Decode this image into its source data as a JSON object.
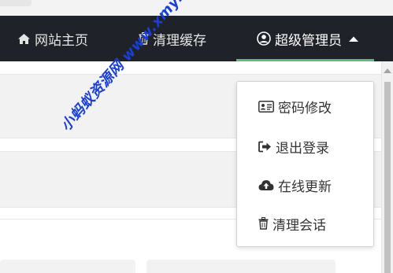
{
  "header": {
    "nav": [
      {
        "label": "网站主页",
        "icon": "home-icon"
      },
      {
        "label": "清理缓存",
        "icon": "trash-icon"
      }
    ],
    "user": {
      "label": "超级管理员",
      "icon": "user-circle-icon",
      "caret": "caret-up-icon"
    },
    "background_color": "#20222a",
    "active_color": "#5fb878"
  },
  "dropdown": {
    "items": [
      {
        "label": "密码修改",
        "icon": "id-card-icon"
      },
      {
        "label": "退出登录",
        "icon": "sign-out-icon"
      },
      {
        "label": "在线更新",
        "icon": "cloud-upload-icon"
      },
      {
        "label": "清理会话",
        "icon": "trash-icon"
      }
    ]
  },
  "watermark": {
    "text": "小蚂蚁资源网 www.xmyzy.com",
    "color": "#1a3fd6"
  }
}
